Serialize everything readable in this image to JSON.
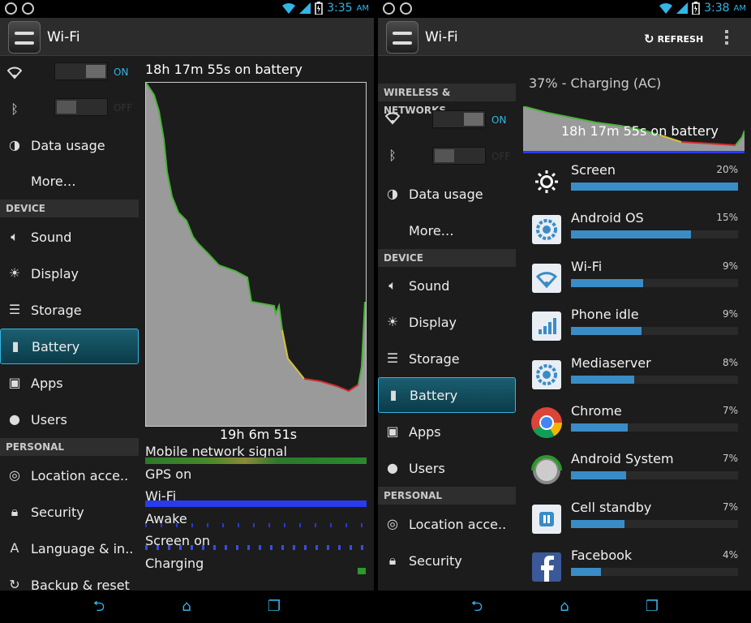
{
  "left": {
    "status": {
      "time": "3:35",
      "ampm": "AM"
    },
    "title": "Wi-Fi",
    "toggles": [
      {
        "state": "ON"
      },
      {
        "state": "OFF"
      }
    ],
    "sidebar": {
      "data_usage": "Data usage",
      "more": "More…",
      "device_header": "DEVICE",
      "sound": "Sound",
      "display": "Display",
      "storage": "Storage",
      "battery": "Battery",
      "apps": "Apps",
      "users": "Users",
      "personal_header": "PERSONAL",
      "location": "Location acce..",
      "security": "Security",
      "language": "Language & in..",
      "backup": "Backup & reset"
    },
    "graph": {
      "title": "18h 17m 55s on battery",
      "duration": "19h 6m 51s",
      "signals": [
        "Mobile network signal",
        "GPS on",
        "Wi-Fi",
        "Awake",
        "Screen on",
        "Charging"
      ]
    }
  },
  "right": {
    "status": {
      "time": "3:38",
      "ampm": "AM"
    },
    "title": "Wi-Fi",
    "refresh_label": "REFRESH",
    "sidebar": {
      "wireless_header": "WIRELESS & NETWORKS",
      "data_usage": "Data usage",
      "more": "More…",
      "device_header": "DEVICE",
      "sound": "Sound",
      "display": "Display",
      "storage": "Storage",
      "battery": "Battery",
      "apps": "Apps",
      "users": "Users",
      "personal_header": "PERSONAL",
      "location": "Location acce..",
      "security": "Security"
    },
    "toggles": [
      {
        "state": "ON"
      },
      {
        "state": "OFF"
      }
    ],
    "charge_status": "37% - Charging (AC)",
    "mini_graph_label": "18h 17m 55s on battery",
    "usage": [
      {
        "name": "Screen",
        "pct": "20%",
        "value": 1.0,
        "icon": "brightness-icon"
      },
      {
        "name": "Android OS",
        "pct": "15%",
        "value": 0.72,
        "icon": "android-os-icon"
      },
      {
        "name": "Wi-Fi",
        "pct": "9%",
        "value": 0.43,
        "icon": "wifi-icon"
      },
      {
        "name": "Phone idle",
        "pct": "9%",
        "value": 0.42,
        "icon": "signal-icon"
      },
      {
        "name": "Mediaserver",
        "pct": "8%",
        "value": 0.38,
        "icon": "mediaserver-icon"
      },
      {
        "name": "Chrome",
        "pct": "7%",
        "value": 0.34,
        "icon": "chrome-icon"
      },
      {
        "name": "Android System",
        "pct": "7%",
        "value": 0.33,
        "icon": "android-system-icon"
      },
      {
        "name": "Cell standby",
        "pct": "7%",
        "value": 0.32,
        "icon": "cell-standby-icon"
      },
      {
        "name": "Facebook",
        "pct": "4%",
        "value": 0.18,
        "icon": "facebook-icon"
      }
    ]
  }
}
